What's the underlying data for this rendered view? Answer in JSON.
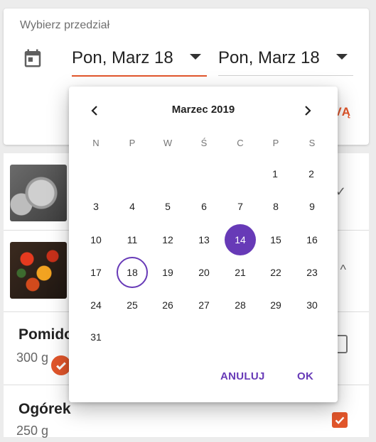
{
  "range": {
    "label": "Wybierz przedział",
    "start": "Pon, Marz 18",
    "end": "Pon, Marz 18",
    "apply_peek": "VĄ"
  },
  "list": {
    "rows": [
      {
        "name": "Pomido",
        "qty": "300 g"
      },
      {
        "name": "Ogórek",
        "qty": "250 g"
      }
    ]
  },
  "picker": {
    "month_label": "Marzec 2019",
    "weekdays": [
      "N",
      "P",
      "W",
      "Ś",
      "C",
      "P",
      "S"
    ],
    "days": [
      "1",
      "2",
      "3",
      "4",
      "5",
      "6",
      "7",
      "8",
      "9",
      "10",
      "11",
      "12",
      "13",
      "14",
      "15",
      "16",
      "17",
      "18",
      "19",
      "20",
      "21",
      "22",
      "23",
      "24",
      "25",
      "26",
      "27",
      "28",
      "29",
      "30",
      "31"
    ],
    "selected_day": "14",
    "today_day": "18",
    "cancel_label": "ANULUJ",
    "ok_label": "OK"
  },
  "colors": {
    "accent": "#e2562b",
    "picker_primary": "#673ab7"
  }
}
